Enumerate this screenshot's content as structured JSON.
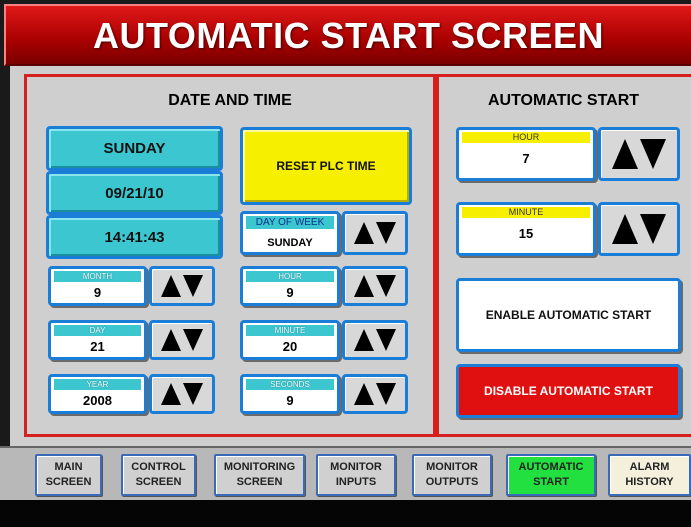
{
  "header": {
    "title": "AUTOMATIC START SCREEN"
  },
  "date_time": {
    "title": "DATE AND TIME",
    "day_name": "SUNDAY",
    "date": "09/21/10",
    "time": "14:41:43",
    "reset_label": "RESET PLC TIME",
    "fields": {
      "month": {
        "label": "MONTH",
        "value": "9"
      },
      "day": {
        "label": "DAY",
        "value": "21"
      },
      "year": {
        "label": "YEAR",
        "value": "2008"
      },
      "day_of_week": {
        "label": "DAY OF WEEK",
        "value": "SUNDAY"
      },
      "hour": {
        "label": "HOUR",
        "value": "9"
      },
      "minute": {
        "label": "MINUTE",
        "value": "20"
      },
      "seconds": {
        "label": "SECONDS",
        "value": "9"
      }
    }
  },
  "auto_start": {
    "title": "AUTOMATIC START",
    "hour": {
      "label": "HOUR",
      "value": "7"
    },
    "minute": {
      "label": "MINUTE",
      "value": "15"
    },
    "enable_label": "ENABLE AUTOMATIC START",
    "disable_label": "DISABLE AUTOMATIC START"
  },
  "nav": [
    {
      "line1": "MAIN",
      "line2": "SCREEN"
    },
    {
      "line1": "CONTROL",
      "line2": "SCREEN"
    },
    {
      "line1": "MONITORING",
      "line2": "SCREEN"
    },
    {
      "line1": "MONITOR",
      "line2": "INPUTS"
    },
    {
      "line1": "MONITOR",
      "line2": "OUTPUTS"
    },
    {
      "line1": "AUTOMATIC",
      "line2": "START",
      "active": true
    },
    {
      "line1": "ALARM",
      "line2": "HISTORY"
    }
  ],
  "colors": {
    "title_red": "#c00000",
    "panel_border": "#d62020",
    "teal": "#3cc6cf",
    "button_border": "#1a7ed8",
    "reset_yellow": "#f6f000",
    "disable_red": "#e01010",
    "active_green": "#22e040"
  },
  "icons": {
    "up": "arrow-up-icon",
    "down": "arrow-down-icon"
  }
}
